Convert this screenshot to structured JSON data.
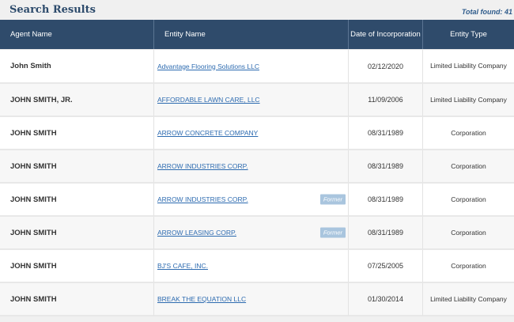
{
  "header": {
    "title": "Search Results",
    "total": "Total found: 41"
  },
  "columns": {
    "agent": "Agent Name",
    "entity": "Entity Name",
    "date": "Date of Incorporation",
    "type": "Entity Type"
  },
  "rows": [
    {
      "agent": "John Smith",
      "entity": "Advantage Flooring Solutions LLC",
      "badge": "",
      "date": "02/12/2020",
      "type": "Limited Liability Company"
    },
    {
      "agent": "JOHN SMITH, JR.",
      "entity": "AFFORDABLE LAWN CARE, LLC",
      "badge": "",
      "date": "11/09/2006",
      "type": "Limited Liability Company"
    },
    {
      "agent": "JOHN SMITH",
      "entity": "ARROW CONCRETE COMPANY",
      "badge": "",
      "date": "08/31/1989",
      "type": "Corporation"
    },
    {
      "agent": "JOHN SMITH",
      "entity": "ARROW INDUSTRIES CORP.",
      "badge": "",
      "date": "08/31/1989",
      "type": "Corporation"
    },
    {
      "agent": "JOHN SMITH",
      "entity": "ARROW INDUSTRIES CORP.",
      "badge": "Former",
      "date": "08/31/1989",
      "type": "Corporation"
    },
    {
      "agent": "JOHN SMITH",
      "entity": "ARROW LEASING CORP.",
      "badge": "Former",
      "date": "08/31/1989",
      "type": "Corporation"
    },
    {
      "agent": "JOHN SMITH",
      "entity": "BJ'S CAFE, INC.",
      "badge": "",
      "date": "07/25/2005",
      "type": "Corporation"
    },
    {
      "agent": "JOHN SMITH",
      "entity": "BREAK THE EQUATION LLC",
      "badge": "",
      "date": "01/30/2014",
      "type": "Limited Liability Company"
    }
  ]
}
